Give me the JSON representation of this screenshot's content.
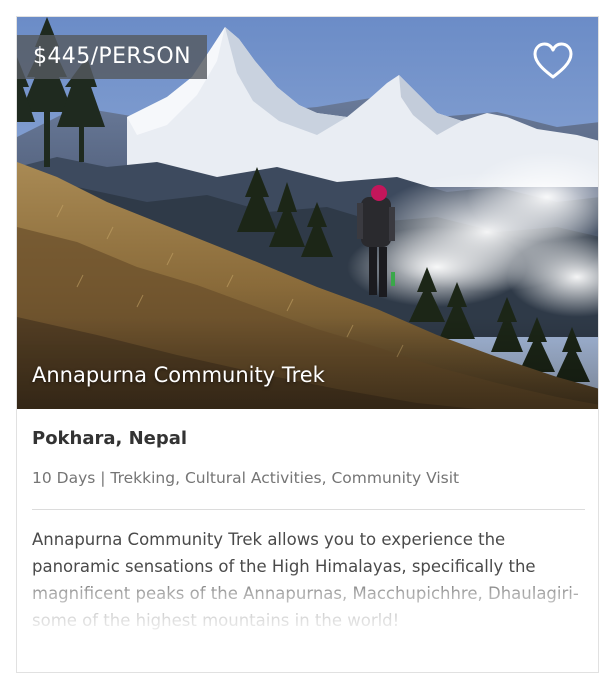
{
  "card": {
    "price": "$445/PERSON",
    "title": "Annapurna Community Trek",
    "location": "Pokhara, Nepal",
    "meta": "10 Days | Trekking, Cultural Activities, Community Visit",
    "description": "Annapurna Community Trek allows you to experience the panoramic sensations of the High Himalayas, specifically the magnificent peaks of the Annapurnas, Macchupichhre, Dhaulagiri- some of the highest mountains in the world!",
    "favorite_icon": "heart-outline-icon"
  },
  "colors": {
    "price_badge_bg": "#555a60",
    "text_dark": "#333333",
    "text_meta": "#757575",
    "divider": "#dcdcdc"
  }
}
